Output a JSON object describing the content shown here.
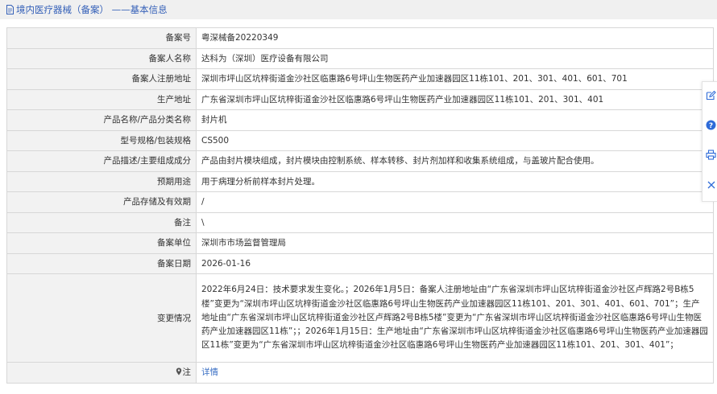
{
  "header": {
    "title": "境内医疗器械（备案） ——基本信息"
  },
  "rows": [
    {
      "label": "备案号",
      "value": "粤深械备20220349"
    },
    {
      "label": "备案人名称",
      "value": "达科为（深圳）医疗设备有限公司"
    },
    {
      "label": "备案人注册地址",
      "value": "深圳市坪山区坑梓街道金沙社区临惠路6号坪山生物医药产业加速器园区11栋101、201、301、401、601、701"
    },
    {
      "label": "生产地址",
      "value": "广东省深圳市坪山区坑梓街道金沙社区临惠路6号坪山生物医药产业加速器园区11栋101、201、301、401"
    },
    {
      "label": "产品名称/产品分类名称",
      "value": "封片机"
    },
    {
      "label": "型号规格/包装规格",
      "value": "CS500"
    },
    {
      "label": "产品描述/主要组成成分",
      "value": "产品由封片模块组成，封片模块由控制系统、样本转移、封片剂加样和收集系统组成，与盖玻片配合使用。"
    },
    {
      "label": "预期用途",
      "value": "用于病理分析前样本封片处理。"
    },
    {
      "label": "产品存储及有效期",
      "value": "/"
    },
    {
      "label": "备注",
      "value": "\\"
    },
    {
      "label": "备案单位",
      "value": "深圳市市场监督管理局"
    },
    {
      "label": "备案日期",
      "value": "2026-01-16"
    },
    {
      "label": "变更情况",
      "value": "2022年6月24日：技术要求发生变化。；2026年1月5日：备案人注册地址由“广东省深圳市坪山区坑梓街道金沙社区卢辉路2号B栋5楼”变更为“深圳市坪山区坑梓街道金沙社区临惠路6号坪山生物医药产业加速器园区11栋101、201、301、401、601、701”；生产地址由“广东省深圳市坪山区坑梓街道金沙社区卢辉路2号B栋5楼”变更为“广东省深圳市坪山区坑梓街道金沙社区临惠路6号坪山生物医药产业加速器园区11栋”；；2026年1月15日：生产地址由“广东省深圳市坪山区坑梓街道金沙社区临惠路6号坪山生物医药产业加速器园区11栋”变更为“广东省深圳市坪山区坑梓街道金沙社区临惠路6号坪山生物医药产业加速器园区11栋101、201、301、401”；"
    }
  ],
  "note_row": {
    "label": "注",
    "link": "详情"
  },
  "colors": {
    "link": "#3460b8",
    "label_bg": "#f2f2f2",
    "border": "#d7d7d7",
    "float_icon": "#2f6bd8"
  },
  "float_bar": {
    "icons": [
      "edit-icon",
      "help-icon",
      "print-icon",
      "close-icon"
    ]
  }
}
